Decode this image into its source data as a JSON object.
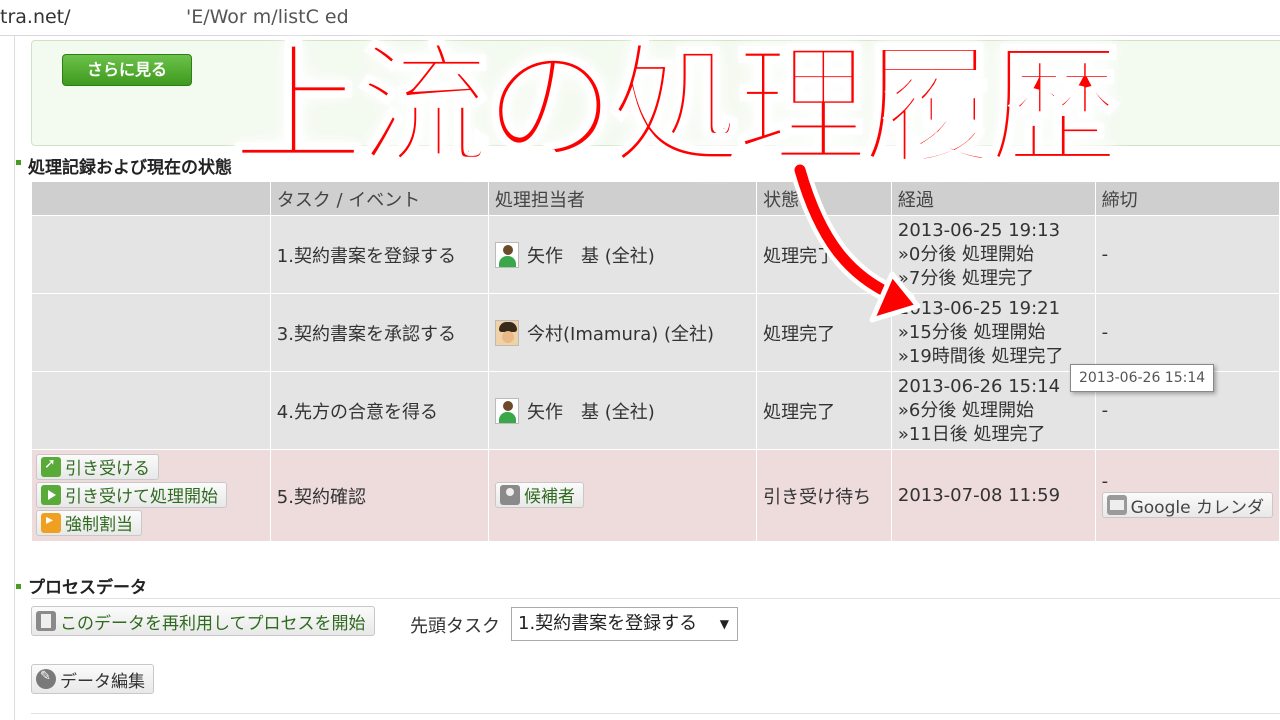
{
  "browser": {
    "url_left": "tra.net/",
    "url_right": "'E/Wor  m/listC  ed"
  },
  "more_button": "さらに見る",
  "sections": {
    "records_title": "処理記録および現在の状態",
    "process_data_title": "プロセスデータ"
  },
  "table": {
    "headers": [
      "",
      "タスク / イベント",
      "処理担当者",
      "状態",
      "経過",
      "締切"
    ],
    "rows": [
      {
        "task": "1.契約書案を登録する",
        "assignee": "矢作　基 (全社)",
        "status": "処理完了",
        "elapsed": [
          "2013-06-25 19:13",
          "»0分後 処理開始",
          "»7分後 処理完了"
        ],
        "deadline": "-"
      },
      {
        "task": "3.契約書案を承認する",
        "assignee": "今村(Imamura) (全社)",
        "status": "処理完了",
        "elapsed": [
          "2013-06-25 19:21",
          "»15分後 処理開始",
          "»19時間後 処理完了"
        ],
        "deadline": "-"
      },
      {
        "task": "4.先方の合意を得る",
        "assignee": "矢作　基 (全社)",
        "status": "処理完了",
        "elapsed": [
          "2013-06-26 15:14",
          "»6分後 処理開始",
          "»11日後 処理完了"
        ],
        "deadline": "-"
      },
      {
        "actions": [
          "引き受ける",
          "引き受けて処理開始",
          "強制割当"
        ],
        "task": "5.契約確認",
        "assignee": "候補者",
        "status": "引き受け待ち",
        "elapsed": "2013-07-08 11:59",
        "deadline": "-",
        "calendar_button": "Google カレンダ"
      }
    ]
  },
  "tooltip": "2013-06-26 15:14",
  "process_data": {
    "reuse_button": "このデータを再利用してプロセスを開始",
    "first_task_label": "先頭タスク",
    "first_task_select": "1.契約書案を登録する",
    "edit_button": "データ編集"
  },
  "overlay": {
    "title": "上流の処理履歴",
    "title_color": "#ff0000",
    "arrow_color": "#ff0000"
  }
}
